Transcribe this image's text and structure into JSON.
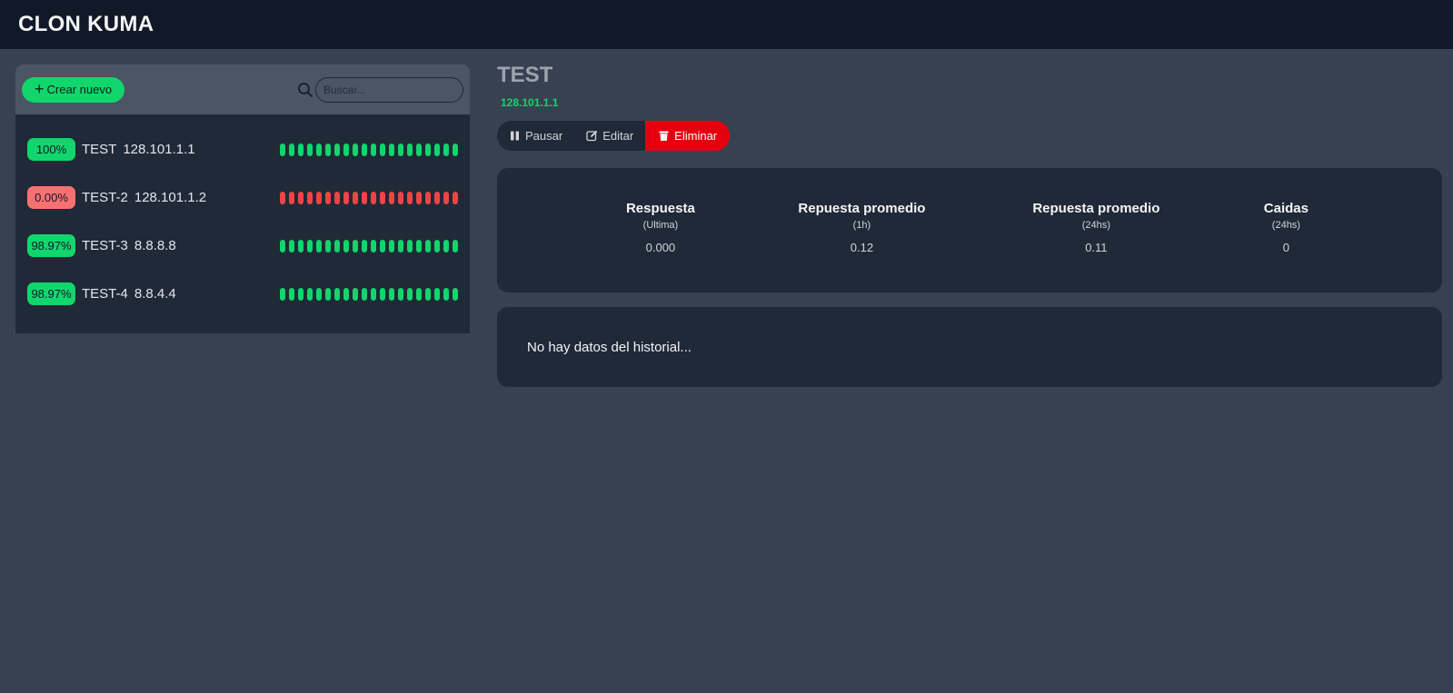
{
  "app": {
    "title": "CLON KUMA"
  },
  "sidebar": {
    "create_label": "Crear nuevo",
    "search_placeholder": "Buscar...",
    "monitors": [
      {
        "uptime": "100%",
        "name": "TEST",
        "host": "128.101.1.1",
        "status": "up",
        "beats": 20
      },
      {
        "uptime": "0.00%",
        "name": "TEST-2",
        "host": "128.101.1.2",
        "status": "down",
        "beats": 20
      },
      {
        "uptime": "98.97%",
        "name": "TEST-3",
        "host": "8.8.8.8",
        "status": "up",
        "beats": 20
      },
      {
        "uptime": "98.97%",
        "name": "TEST-4",
        "host": "8.8.4.4",
        "status": "up",
        "beats": 20
      }
    ]
  },
  "detail": {
    "title": "TEST",
    "url": "128.101.1.1",
    "actions": {
      "pause": "Pausar",
      "edit": "Editar",
      "delete": "Eliminar"
    },
    "stats": [
      {
        "label": "Respuesta",
        "period": "(Ultima)",
        "value": "0.000"
      },
      {
        "label": "Repuesta promedio",
        "period": "(1h)",
        "value": "0.12"
      },
      {
        "label": "Repuesta promedio",
        "period": "(24hs)",
        "value": "0.11"
      },
      {
        "label": "Caidas",
        "period": "(24hs)",
        "value": "0"
      }
    ],
    "history_empty": "No hay datos del historial..."
  },
  "colors": {
    "up": "#10d66c",
    "down": "#ef4444",
    "danger": "#e5000f",
    "background": "#374151",
    "card": "#1f2937",
    "topbar": "#111827"
  },
  "icons": {
    "search": "search-icon",
    "plus": "plus-icon",
    "pause": "pause-icon",
    "edit": "edit-icon",
    "delete": "trash-icon"
  }
}
